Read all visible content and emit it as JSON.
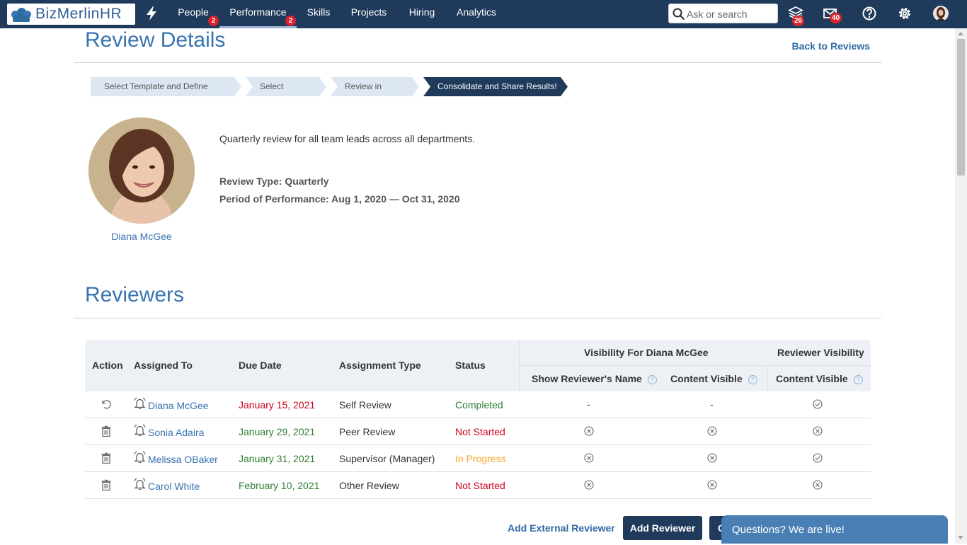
{
  "app": {
    "logo_text": "BizMerlinHR"
  },
  "nav": {
    "items": [
      {
        "label": "People",
        "badge": "2"
      },
      {
        "label": "Performance",
        "badge": "2"
      },
      {
        "label": "Skills"
      },
      {
        "label": "Projects"
      },
      {
        "label": "Hiring"
      },
      {
        "label": "Analytics"
      }
    ],
    "search_placeholder": "Ask or search",
    "layers_badge": "26",
    "mail_badge": "40"
  },
  "header": {
    "title": "Review Details",
    "back_link": "Back to Reviews"
  },
  "steps": [
    {
      "label": "Select Template and Define Metrics"
    },
    {
      "label": "Select Reviewers"
    },
    {
      "label": "Review in Progress"
    },
    {
      "label": "Consolidate and Share Results!",
      "current": true
    }
  ],
  "review": {
    "employee_name": "Diana McGee",
    "description": "Quarterly review for all team leads across all departments.",
    "type_line": "Review Type: Quarterly",
    "period_line": "Period of Performance: Aug 1, 2020 — Oct 31, 2020"
  },
  "reviewers": {
    "title": "Reviewers",
    "columns": {
      "action": "Action",
      "assigned_to": "Assigned To",
      "due_date": "Due Date",
      "assignment_type": "Assignment Type",
      "status": "Status",
      "visibility_group": "Visibility For Diana McGee",
      "show_name": "Show Reviewer's Name",
      "content_visible": "Content Visible",
      "reviewer_visibility_group": "Reviewer Visibility",
      "reviewer_content_visible": "Content Visible"
    },
    "rows": [
      {
        "action_icon": "undo-icon",
        "name": "Diana McGee",
        "due": "January 15, 2021",
        "due_color": "red",
        "type": "Self Review",
        "status": "Completed",
        "status_color": "green",
        "show_name": "-",
        "content_visible": "-",
        "reviewer_content": "check-icon"
      },
      {
        "action_icon": "trash-icon",
        "name": "Sonia Adaira",
        "due": "January 29, 2021",
        "due_color": "green",
        "type": "Peer Review",
        "status": "Not Started",
        "status_color": "red",
        "show_name": "x-icon",
        "content_visible": "x-icon",
        "reviewer_content": "x-icon"
      },
      {
        "action_icon": "trash-icon",
        "name": "Melissa OBaker",
        "due": "January 31, 2021",
        "due_color": "green",
        "type": "Supervisor (Manager)",
        "status": "In Progress",
        "status_color": "orange",
        "show_name": "x-icon",
        "content_visible": "x-icon",
        "reviewer_content": "check-icon"
      },
      {
        "action_icon": "trash-icon",
        "name": "Carol White",
        "due": "February 10, 2021",
        "due_color": "green",
        "type": "Other Review",
        "status": "Not Started",
        "status_color": "red",
        "show_name": "x-icon",
        "content_visible": "x-icon",
        "reviewer_content": "x-icon"
      }
    ]
  },
  "actions": {
    "add_external": "Add External Reviewer",
    "add_reviewer": "Add Reviewer",
    "third_button_fragment": "C"
  },
  "chat": {
    "label": "Questions? We are live!"
  },
  "colors": {
    "nav_bg": "#1f3a5b",
    "accent": "#3874b0",
    "badge": "#d9232e",
    "red": "#d0021b",
    "green": "#2e7d32",
    "orange": "#f5a623"
  }
}
